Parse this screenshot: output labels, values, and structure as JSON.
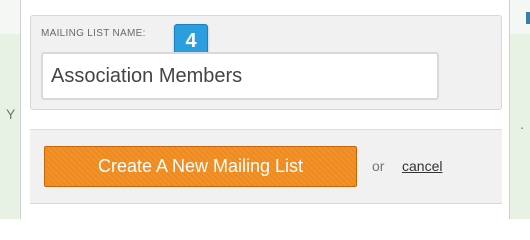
{
  "dialog": {
    "name_field": {
      "label": "MAILING LIST NAME:",
      "value": "Association Members"
    },
    "step_badge": "4",
    "create_button": "Create A New Mailing List",
    "or_text": "or",
    "cancel_link": "cancel"
  },
  "colors": {
    "button_orange": "#ef8a1d",
    "badge_blue": "#2b9ee0",
    "panel_gray": "#f1f1f1"
  }
}
